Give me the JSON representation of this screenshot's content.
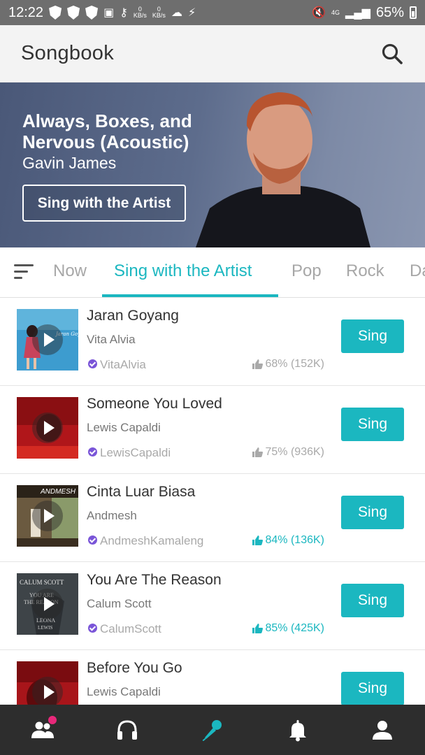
{
  "status_bar": {
    "time": "12:22",
    "net_down": "0",
    "net_up": "0",
    "net_unit": "KB/s",
    "signal_type": "4G",
    "battery": "65%"
  },
  "app_bar": {
    "title": "Songbook",
    "search_icon": "search-icon"
  },
  "hero": {
    "title": "Always, Boxes, and Nervous (Acoustic)",
    "artist": "Gavin James",
    "button_label": "Sing with the Artist"
  },
  "tabs": {
    "items": [
      "Now",
      "Sing with the Artist",
      "Pop",
      "Rock",
      "Da"
    ],
    "active": "Sing with the Artist"
  },
  "songs": [
    {
      "title": "Jaran Goyang",
      "artist": "Vita Alvia",
      "handle": "VitaAlvia",
      "rating": "68% (152K)",
      "highlight": false,
      "button": "Sing"
    },
    {
      "title": "Someone You Loved",
      "artist": "Lewis Capaldi",
      "handle": "LewisCapaldi",
      "rating": "75% (936K)",
      "highlight": false,
      "button": "Sing"
    },
    {
      "title": "Cinta Luar Biasa",
      "artist": "Andmesh",
      "handle": "AndmeshKamaleng",
      "rating": "84% (136K)",
      "highlight": true,
      "button": "Sing"
    },
    {
      "title": "You Are The Reason",
      "artist": "Calum Scott",
      "handle": "CalumScott",
      "rating": "85% (425K)",
      "highlight": true,
      "button": "Sing"
    },
    {
      "title": "Before You Go",
      "artist": "Lewis Capaldi",
      "handle": "",
      "rating": "",
      "highlight": false,
      "button": "Sing"
    }
  ],
  "thumb_text": {
    "song1": "Jaran Goyang",
    "song3": "ANDMESH",
    "song4_line1": "CALUM SCOTT",
    "song4_line2": "YOU ARE",
    "song4_line3": "THE REASON",
    "song4_line4": "LEONA",
    "song4_line5": "LEWIS"
  },
  "bottom_nav": [
    {
      "icon": "people-icon",
      "active": false,
      "badge": true
    },
    {
      "icon": "headphones-icon",
      "active": false,
      "badge": false
    },
    {
      "icon": "microphone-icon",
      "active": true,
      "badge": false
    },
    {
      "icon": "bell-icon",
      "active": false,
      "badge": false
    },
    {
      "icon": "profile-icon",
      "active": false,
      "badge": false
    }
  ],
  "colors": {
    "accent": "#1bb7c0",
    "verified": "#7a55d8",
    "status_bar": "#6e6e6e",
    "bottom_nav": "#2d2d2d",
    "badge": "#e8287a"
  }
}
